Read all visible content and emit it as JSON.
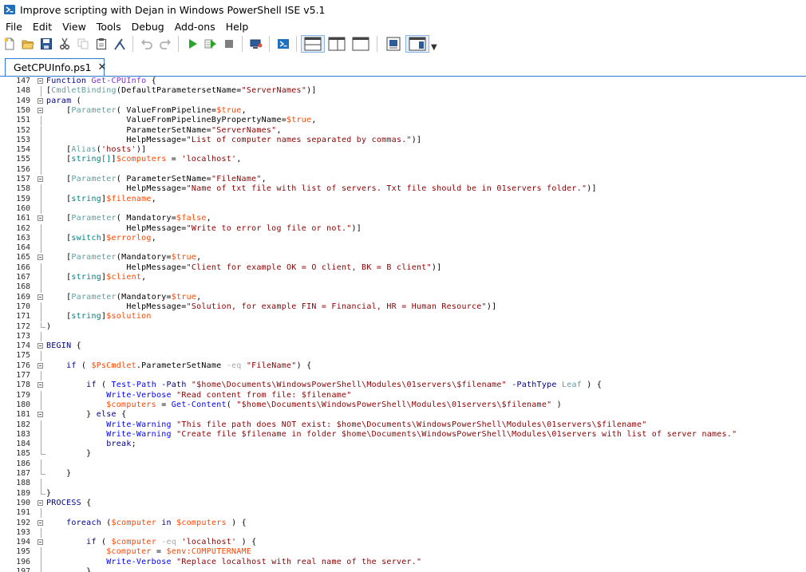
{
  "window": {
    "title": "Improve scripting with Dejan in Windows PowerShell ISE v5.1"
  },
  "menu": [
    "File",
    "Edit",
    "View",
    "Tools",
    "Debug",
    "Add-ons",
    "Help"
  ],
  "toolbar": {
    "buttons": [
      {
        "name": "new-file-icon"
      },
      {
        "name": "open-folder-icon"
      },
      {
        "name": "save-icon"
      },
      {
        "name": "cut-icon"
      },
      {
        "name": "copy-icon"
      },
      {
        "name": "paste-icon"
      },
      {
        "name": "clear-console-icon"
      },
      {
        "name": "undo-icon"
      },
      {
        "name": "redo-icon"
      },
      {
        "name": "run-script-icon"
      },
      {
        "name": "run-selection-icon"
      },
      {
        "name": "stop-icon"
      },
      {
        "name": "remote-powershell-icon"
      },
      {
        "name": "powershell-console-icon"
      },
      {
        "name": "script-pane-top-icon"
      },
      {
        "name": "script-pane-right-icon"
      },
      {
        "name": "script-pane-maximized-icon"
      },
      {
        "name": "command-addon-icon"
      },
      {
        "name": "show-command-window-icon"
      }
    ],
    "colors": {
      "run": "#2aa52a",
      "stop": "#7f7f7f",
      "accent": "#2b79d5"
    }
  },
  "tabs": [
    {
      "label": "GetCPUInfo.ps1",
      "close": "✕",
      "active": true
    }
  ],
  "editor": {
    "lines": [
      {
        "n": "147",
        "fold": "box",
        "tokens": [
          [
            "kw",
            "Function "
          ],
          [
            "func",
            "Get-CPUInfo"
          ],
          [
            "plain",
            " {"
          ]
        ]
      },
      {
        "n": "148",
        "fold": "line",
        "tokens": [
          [
            "plain",
            "["
          ],
          [
            "attr",
            "CmdletBinding"
          ],
          [
            "plain",
            "(DefaultParametersetName="
          ],
          [
            "str",
            "\"ServerNames\""
          ],
          [
            "plain",
            ")]"
          ]
        ]
      },
      {
        "n": "149",
        "fold": "box",
        "tokens": [
          [
            "kw",
            "param"
          ],
          [
            "plain",
            " ("
          ]
        ]
      },
      {
        "n": "150",
        "fold": "box",
        "tokens": [
          [
            "plain",
            "    ["
          ],
          [
            "attr",
            "Parameter"
          ],
          [
            "plain",
            "( ValueFromPipeline="
          ],
          [
            "var",
            "$true"
          ],
          [
            "plain",
            ","
          ]
        ]
      },
      {
        "n": "151",
        "fold": "line",
        "tokens": [
          [
            "plain",
            "                ValueFromPipelineByPropertyName="
          ],
          [
            "var",
            "$true"
          ],
          [
            "plain",
            ","
          ]
        ]
      },
      {
        "n": "152",
        "fold": "line",
        "tokens": [
          [
            "plain",
            "                ParameterSetName="
          ],
          [
            "str",
            "\"ServerNames\""
          ],
          [
            "plain",
            ","
          ]
        ]
      },
      {
        "n": "153",
        "fold": "line",
        "tokens": [
          [
            "plain",
            "                HelpMessage="
          ],
          [
            "str",
            "\"List of computer names separated by commas.\""
          ],
          [
            "plain",
            ")]"
          ]
        ]
      },
      {
        "n": "154",
        "fold": "line",
        "tokens": [
          [
            "plain",
            "    ["
          ],
          [
            "attr",
            "Alias"
          ],
          [
            "plain",
            "("
          ],
          [
            "str",
            "'hosts'"
          ],
          [
            "plain",
            ")]"
          ]
        ]
      },
      {
        "n": "155",
        "fold": "line",
        "tokens": [
          [
            "plain",
            "    ["
          ],
          [
            "type",
            "string[]"
          ],
          [
            "plain",
            "]"
          ],
          [
            "var",
            "$computers"
          ],
          [
            "plain",
            " = "
          ],
          [
            "str",
            "'localhost'"
          ],
          [
            "plain",
            ","
          ]
        ]
      },
      {
        "n": "156",
        "fold": "line",
        "tokens": []
      },
      {
        "n": "157",
        "fold": "box",
        "tokens": [
          [
            "plain",
            "    ["
          ],
          [
            "attr",
            "Parameter"
          ],
          [
            "plain",
            "( ParameterSetName="
          ],
          [
            "str",
            "\"FileName\""
          ],
          [
            "plain",
            ","
          ]
        ]
      },
      {
        "n": "158",
        "fold": "line",
        "tokens": [
          [
            "plain",
            "                HelpMessage="
          ],
          [
            "str",
            "\"Name of txt file with list of servers. Txt file should be in 01servers folder.\""
          ],
          [
            "plain",
            ")]"
          ]
        ]
      },
      {
        "n": "159",
        "fold": "line",
        "tokens": [
          [
            "plain",
            "    ["
          ],
          [
            "type",
            "string"
          ],
          [
            "plain",
            "]"
          ],
          [
            "var",
            "$filename"
          ],
          [
            "plain",
            ","
          ]
        ]
      },
      {
        "n": "160",
        "fold": "line",
        "tokens": []
      },
      {
        "n": "161",
        "fold": "box",
        "tokens": [
          [
            "plain",
            "    ["
          ],
          [
            "attr",
            "Parameter"
          ],
          [
            "plain",
            "( Mandatory="
          ],
          [
            "var",
            "$false"
          ],
          [
            "plain",
            ","
          ]
        ]
      },
      {
        "n": "162",
        "fold": "line",
        "tokens": [
          [
            "plain",
            "                HelpMessage="
          ],
          [
            "str",
            "\"Write to error log file or not.\""
          ],
          [
            "plain",
            ")]"
          ]
        ]
      },
      {
        "n": "163",
        "fold": "line",
        "tokens": [
          [
            "plain",
            "    ["
          ],
          [
            "type",
            "switch"
          ],
          [
            "plain",
            "]"
          ],
          [
            "var",
            "$errorlog"
          ],
          [
            "plain",
            ","
          ]
        ]
      },
      {
        "n": "164",
        "fold": "line",
        "tokens": []
      },
      {
        "n": "165",
        "fold": "box",
        "tokens": [
          [
            "plain",
            "    ["
          ],
          [
            "attr",
            "Parameter"
          ],
          [
            "plain",
            "(Mandatory="
          ],
          [
            "var",
            "$true"
          ],
          [
            "plain",
            ","
          ]
        ]
      },
      {
        "n": "166",
        "fold": "line",
        "tokens": [
          [
            "plain",
            "                HelpMessage="
          ],
          [
            "str",
            "\"Client for example OK = O client, BK = B client\""
          ],
          [
            "plain",
            ")]"
          ]
        ]
      },
      {
        "n": "167",
        "fold": "line",
        "tokens": [
          [
            "plain",
            "    ["
          ],
          [
            "type",
            "string"
          ],
          [
            "plain",
            "]"
          ],
          [
            "var",
            "$client"
          ],
          [
            "plain",
            ","
          ]
        ]
      },
      {
        "n": "168",
        "fold": "line",
        "tokens": []
      },
      {
        "n": "169",
        "fold": "box",
        "tokens": [
          [
            "plain",
            "    ["
          ],
          [
            "attr",
            "Parameter"
          ],
          [
            "plain",
            "(Mandatory="
          ],
          [
            "var",
            "$true"
          ],
          [
            "plain",
            ","
          ]
        ]
      },
      {
        "n": "170",
        "fold": "line",
        "tokens": [
          [
            "plain",
            "                HelpMessage="
          ],
          [
            "str",
            "\"Solution, for example FIN = Financial, HR = Human Resource\""
          ],
          [
            "plain",
            ")]"
          ]
        ]
      },
      {
        "n": "171",
        "fold": "line",
        "tokens": [
          [
            "plain",
            "    ["
          ],
          [
            "type",
            "string"
          ],
          [
            "plain",
            "]"
          ],
          [
            "var",
            "$solution"
          ]
        ]
      },
      {
        "n": "172",
        "fold": "end",
        "tokens": [
          [
            "plain",
            ")"
          ]
        ]
      },
      {
        "n": "173",
        "fold": "line",
        "tokens": []
      },
      {
        "n": "174",
        "fold": "box",
        "tokens": [
          [
            "kw",
            "BEGIN"
          ],
          [
            "plain",
            " {"
          ]
        ]
      },
      {
        "n": "175",
        "fold": "line",
        "tokens": []
      },
      {
        "n": "176",
        "fold": "box",
        "tokens": [
          [
            "plain",
            "    "
          ],
          [
            "kw",
            "if"
          ],
          [
            "plain",
            " ( "
          ],
          [
            "var",
            "$PsCmdlet"
          ],
          [
            "plain",
            ".ParameterSetName "
          ],
          [
            "op",
            "-eq"
          ],
          [
            "plain",
            " "
          ],
          [
            "str",
            "\"FileName\""
          ],
          [
            "plain",
            ") {"
          ]
        ]
      },
      {
        "n": "177",
        "fold": "line",
        "tokens": []
      },
      {
        "n": "178",
        "fold": "box",
        "tokens": [
          [
            "plain",
            "        "
          ],
          [
            "kw",
            "if"
          ],
          [
            "plain",
            " ( "
          ],
          [
            "cmd",
            "Test-Path"
          ],
          [
            "plain",
            " "
          ],
          [
            "param",
            "-Path"
          ],
          [
            "plain",
            " "
          ],
          [
            "str",
            "\"$home\\Documents\\WindowsPowerShell\\Modules\\01servers\\$filename\""
          ],
          [
            "plain",
            " "
          ],
          [
            "param",
            "-PathType"
          ],
          [
            "plain",
            " "
          ],
          [
            "attr",
            "Leaf"
          ],
          [
            "plain",
            " ) {"
          ]
        ]
      },
      {
        "n": "179",
        "fold": "line",
        "tokens": [
          [
            "plain",
            "            "
          ],
          [
            "cmd",
            "Write-Verbose"
          ],
          [
            "plain",
            " "
          ],
          [
            "str",
            "\"Read content from file: $filename\""
          ]
        ]
      },
      {
        "n": "180",
        "fold": "line",
        "tokens": [
          [
            "plain",
            "            "
          ],
          [
            "var",
            "$computers"
          ],
          [
            "plain",
            " = "
          ],
          [
            "cmd",
            "Get-Content"
          ],
          [
            "plain",
            "( "
          ],
          [
            "str",
            "\"$home\\Documents\\WindowsPowerShell\\Modules\\01servers\\$filename\""
          ],
          [
            "plain",
            " )"
          ]
        ]
      },
      {
        "n": "181",
        "fold": "box",
        "tokens": [
          [
            "plain",
            "        } "
          ],
          [
            "kw",
            "else"
          ],
          [
            "plain",
            " {"
          ]
        ]
      },
      {
        "n": "182",
        "fold": "line",
        "tokens": [
          [
            "plain",
            "            "
          ],
          [
            "cmd",
            "Write-Warning"
          ],
          [
            "plain",
            " "
          ],
          [
            "str",
            "\"This file path does NOT exist: $home\\Documents\\WindowsPowerShell\\Modules\\01servers\\$filename\""
          ]
        ]
      },
      {
        "n": "183",
        "fold": "line",
        "tokens": [
          [
            "plain",
            "            "
          ],
          [
            "cmd",
            "Write-Warning"
          ],
          [
            "plain",
            " "
          ],
          [
            "str",
            "\"Create file $filename in folder $home\\Documents\\WindowsPowerShell\\Modules\\01servers with list of server names.\""
          ]
        ]
      },
      {
        "n": "184",
        "fold": "line",
        "tokens": [
          [
            "plain",
            "            "
          ],
          [
            "kw",
            "break"
          ],
          [
            "plain",
            ";"
          ]
        ]
      },
      {
        "n": "185",
        "fold": "end",
        "tokens": [
          [
            "plain",
            "        }"
          ]
        ]
      },
      {
        "n": "186",
        "fold": "line",
        "tokens": []
      },
      {
        "n": "187",
        "fold": "end",
        "tokens": [
          [
            "plain",
            "    }"
          ]
        ]
      },
      {
        "n": "188",
        "fold": "line",
        "tokens": []
      },
      {
        "n": "189",
        "fold": "end",
        "tokens": [
          [
            "plain",
            "}"
          ]
        ]
      },
      {
        "n": "190",
        "fold": "box",
        "tokens": [
          [
            "kw",
            "PROCESS"
          ],
          [
            "plain",
            " {"
          ]
        ]
      },
      {
        "n": "191",
        "fold": "line",
        "tokens": []
      },
      {
        "n": "192",
        "fold": "box",
        "tokens": [
          [
            "plain",
            "    "
          ],
          [
            "kw",
            "foreach"
          ],
          [
            "plain",
            " ("
          ],
          [
            "var",
            "$computer"
          ],
          [
            "plain",
            " "
          ],
          [
            "kw",
            "in"
          ],
          [
            "plain",
            " "
          ],
          [
            "var",
            "$computers"
          ],
          [
            "plain",
            " ) {"
          ]
        ]
      },
      {
        "n": "193",
        "fold": "line",
        "tokens": []
      },
      {
        "n": "194",
        "fold": "box",
        "tokens": [
          [
            "plain",
            "        "
          ],
          [
            "kw",
            "if"
          ],
          [
            "plain",
            " ( "
          ],
          [
            "var",
            "$computer"
          ],
          [
            "plain",
            " "
          ],
          [
            "op",
            "-eq"
          ],
          [
            "plain",
            " "
          ],
          [
            "str",
            "'localhost'"
          ],
          [
            "plain",
            " ) {"
          ]
        ]
      },
      {
        "n": "195",
        "fold": "line",
        "tokens": [
          [
            "plain",
            "            "
          ],
          [
            "var",
            "$computer"
          ],
          [
            "plain",
            " = "
          ],
          [
            "var",
            "$env:COMPUTERNAME"
          ]
        ]
      },
      {
        "n": "196",
        "fold": "line",
        "tokens": [
          [
            "plain",
            "            "
          ],
          [
            "cmd",
            "Write-Verbose"
          ],
          [
            "plain",
            " "
          ],
          [
            "str",
            "\"Replace localhost with real name of the server.\""
          ]
        ]
      },
      {
        "n": "197",
        "fold": "line",
        "tokens": [
          [
            "plain",
            "        }"
          ]
        ]
      }
    ]
  }
}
